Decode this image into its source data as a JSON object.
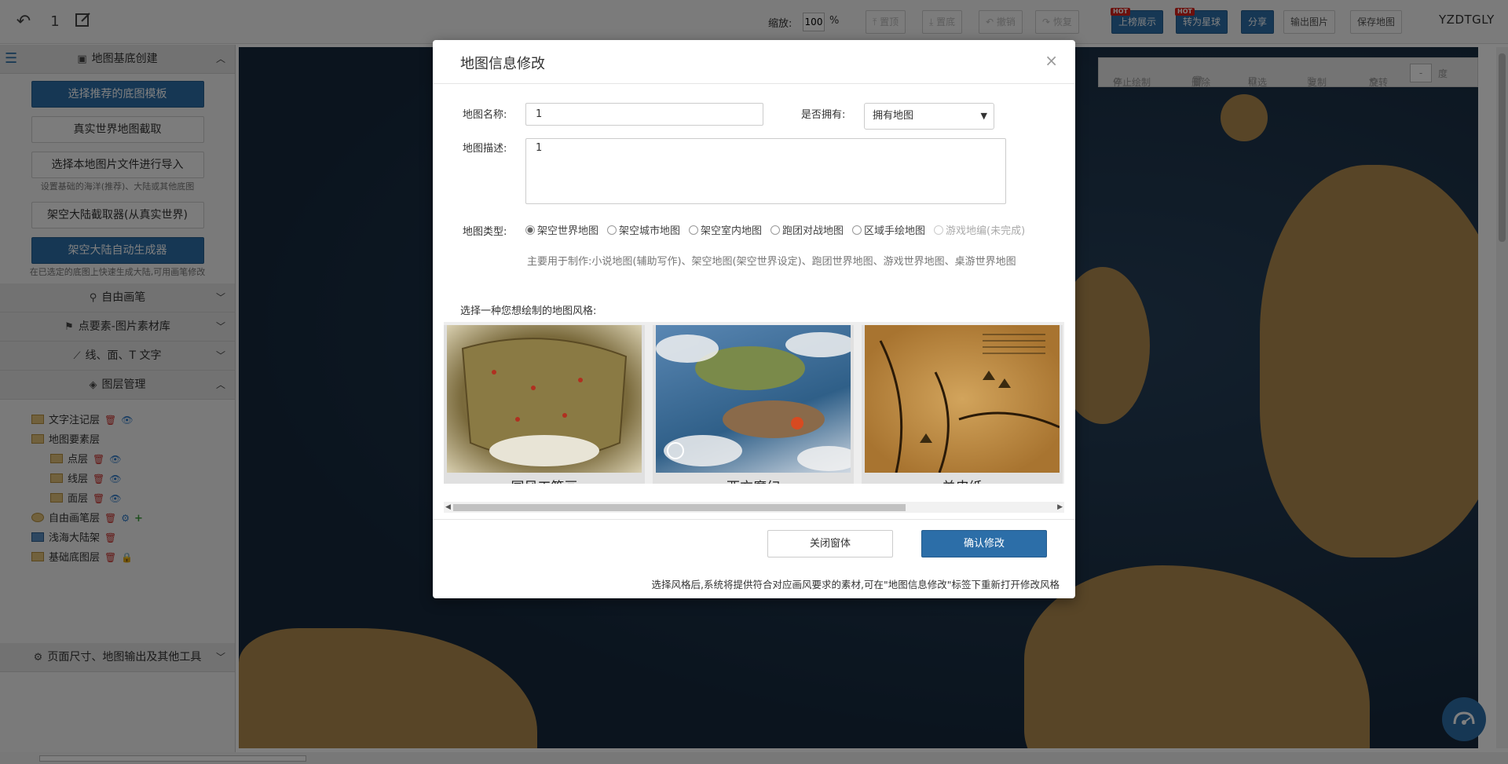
{
  "toolbar": {
    "undo_label": "↶",
    "count": "1",
    "edit_icon": "edit-icon",
    "zoom_label": "缩放:",
    "zoom_value": "100",
    "zoom_unit": "%",
    "buttons": [
      {
        "label": "置顶"
      },
      {
        "label": "置底"
      },
      {
        "label": "撤销"
      },
      {
        "label": "恢复"
      }
    ],
    "upload_label": "上榜展示",
    "planet_label": "转为星球",
    "hot_badge": "HOT",
    "share_label": "分享",
    "export_label": "输出图片",
    "save_label": "保存地图",
    "user": "YZDTGLY"
  },
  "sidebar": {
    "section_base": "地图基底创建",
    "btn_template": "选择推荐的底图模板",
    "btn_real_world": "真实世界地图截取",
    "btn_import": "选择本地图片文件进行导入",
    "hint_import": "设置基础的海洋(推荐)、大陆或其他底图",
    "btn_fictional_cut": "架空大陆截取器(从真实世界)",
    "btn_auto_gen": "架空大陆自动生成器",
    "hint_auto_gen": "在已选定的底图上快速生成大陆,可用画笔修改",
    "section_brush": "自由画笔",
    "section_point": "点要素-图片素材库",
    "section_line": "线、面、T 文字",
    "section_layers": "图层管理",
    "layers": [
      {
        "label": "文字注记层"
      },
      {
        "label": "地图要素层"
      },
      {
        "label": "点层"
      },
      {
        "label": "线层"
      },
      {
        "label": "面层"
      },
      {
        "label": "自由画笔层"
      },
      {
        "label": "浅海大陆架"
      },
      {
        "label": "基础底图层"
      }
    ],
    "section_page": "页面尺寸、地图输出及其他工具"
  },
  "map_toolbar": {
    "stop_draw": "停止绘制",
    "delete": "删除",
    "box_select": "框选",
    "copy": "复制",
    "rotate": "旋转",
    "rotate_value": "-",
    "degree": "度"
  },
  "modal": {
    "title": "地图信息修改",
    "close": "×",
    "name_label": "地图名称:",
    "name_value": "1",
    "own_label": "是否拥有:",
    "own_value": "拥有地图",
    "desc_label": "地图描述:",
    "desc_value": "1",
    "type_label": "地图类型:",
    "types": [
      {
        "label": "架空世界地图"
      },
      {
        "label": "架空城市地图"
      },
      {
        "label": "架空室内地图"
      },
      {
        "label": "跑团对战地图"
      },
      {
        "label": "区域手绘地图"
      },
      {
        "label": "游戏地编(未完成)"
      }
    ],
    "usage_text": "主要用于制作:小说地图(辅助写作)、架空地图(架空世界设定)、跑团世界地图、游戏世界地图、桌游世界地图",
    "style_prompt": "选择一种您想绘制的地图风格:",
    "styles": [
      {
        "name": "国风工笔画"
      },
      {
        "name": "西方魔幻"
      },
      {
        "name": "羊皮纸"
      }
    ],
    "btn_close": "关闭窗体",
    "btn_confirm": "确认修改",
    "footer_note": "选择风格后,系统将提供符合对应画风要求的素材,可在\"地图信息修改\"标签下重新打开修改风格"
  },
  "colors": {
    "primary": "#2c6ea8",
    "danger": "#c9302c",
    "hot": "#d9211b",
    "sea": "#16293d",
    "land": "#b08a4e"
  }
}
